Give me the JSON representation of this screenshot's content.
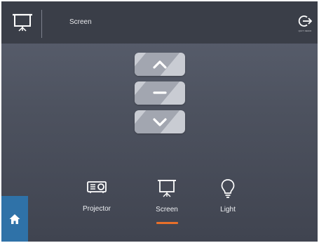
{
  "header": {
    "title": "Screen",
    "exit_label": "QUIT DEMO",
    "icon": "projection-screen-icon",
    "exit_icon": "exit-arrow-icon"
  },
  "controls": [
    {
      "name": "screen-up-button",
      "icon": "chevron-up-icon"
    },
    {
      "name": "screen-stop-button",
      "icon": "minus-icon"
    },
    {
      "name": "screen-down-button",
      "icon": "chevron-down-icon"
    }
  ],
  "devices": [
    {
      "label": "Projector",
      "icon": "projector-icon",
      "active": false
    },
    {
      "label": "Screen",
      "icon": "projection-screen-icon",
      "active": true
    },
    {
      "label": "Light",
      "icon": "lightbulb-icon",
      "active": false
    }
  ],
  "home": {
    "icon": "home-icon"
  },
  "colors": {
    "header_bg": "#3a3e48",
    "panel_bg": "#4d525f",
    "accent": "#e8702a",
    "home_bg": "#2f72a8",
    "button_light": "#c9ccd3",
    "button_dark": "#a2a6b0"
  }
}
